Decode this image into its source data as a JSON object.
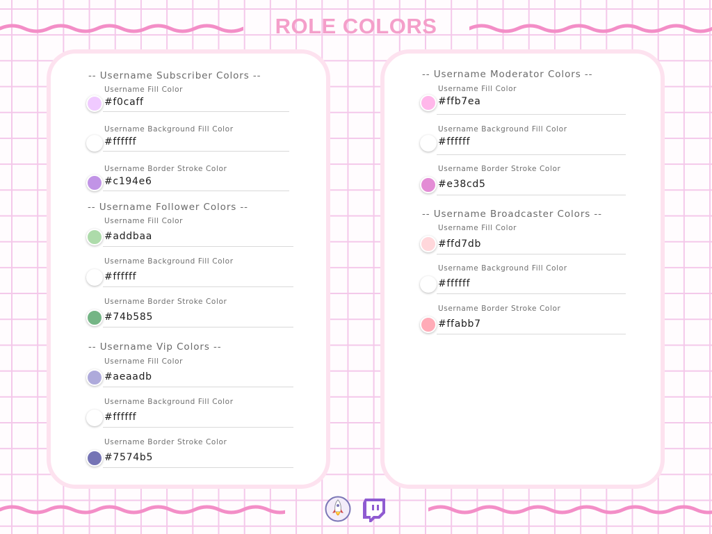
{
  "page": {
    "title": "ROLE COLORS"
  },
  "colors": {
    "accent": "#f49fca",
    "wave": "#f38ec7",
    "grid": "#f4c8ea",
    "panel_border": "#fde2ef",
    "twitch": "#8f5bd1"
  },
  "groups": [
    {
      "title": "-- Username Subscriber Colors --",
      "fields": [
        {
          "label": "Username Fill Color",
          "value": "#f0caff"
        },
        {
          "label": "Username Background Fill Color",
          "value": "#ffffff"
        },
        {
          "label": "Username Border Stroke Color",
          "value": "#c194e6"
        }
      ]
    },
    {
      "title": "-- Username Follower Colors --",
      "fields": [
        {
          "label": "Username Fill Color",
          "value": "#addbaa"
        },
        {
          "label": "Username Background Fill Color",
          "value": "#ffffff"
        },
        {
          "label": "Username Border Stroke Color",
          "value": "#74b585"
        }
      ]
    },
    {
      "title": "-- Username Vip Colors --",
      "fields": [
        {
          "label": "Username Fill Color",
          "value": "#aeaadb"
        },
        {
          "label": "Username Background Fill Color",
          "value": "#ffffff"
        },
        {
          "label": "Username Border Stroke Color",
          "value": "#7574b5"
        }
      ]
    },
    {
      "title": "-- Username Moderator Colors --",
      "fields": [
        {
          "label": "Username Fill Color",
          "value": "#ffb7ea"
        },
        {
          "label": "Username Background Fill Color",
          "value": "#ffffff"
        },
        {
          "label": "Username Border Stroke Color",
          "value": "#e38cd5"
        }
      ]
    },
    {
      "title": "-- Username Broadcaster Colors --",
      "fields": [
        {
          "label": "Username Fill Color",
          "value": "#ffd7db"
        },
        {
          "label": "Username Background Fill Color",
          "value": "#ffffff"
        },
        {
          "label": "Username Border Stroke Color",
          "value": "#ffabb7"
        }
      ]
    }
  ],
  "footer": {
    "icons": [
      "rocket-logo-icon",
      "twitch-icon"
    ]
  }
}
